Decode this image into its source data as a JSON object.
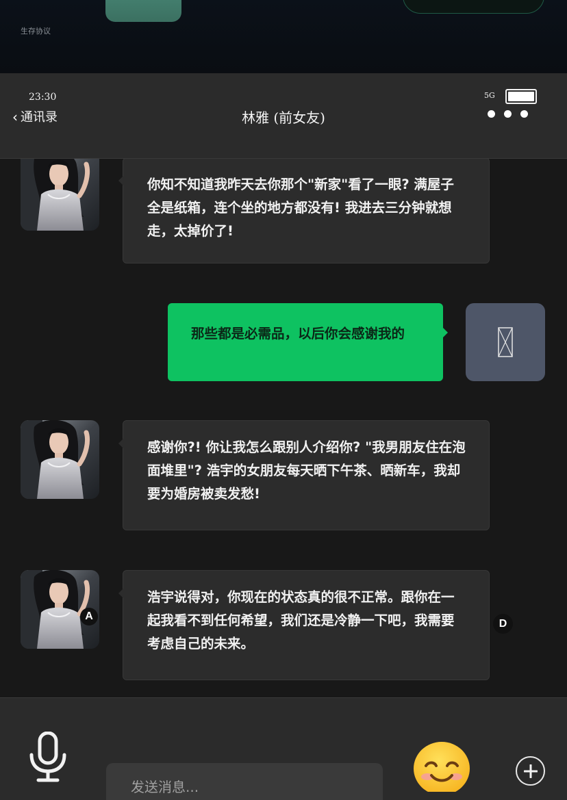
{
  "background_app": {
    "protocol_text": "生存协议"
  },
  "status_bar": {
    "time": "23:30",
    "signal": "5G",
    "battery_level_percent": 100
  },
  "nav": {
    "back_label": "通讯录",
    "back_icon": "chevron-left-icon",
    "title": "林雅 (前女友)",
    "more_icon": "more-dots-icon"
  },
  "messages": [
    {
      "sender": "林雅",
      "direction": "incoming",
      "text": "你知不知道我昨天去你那个\"新家\"看了一眼? 满屋子全是纸箱，连个坐的地方都没有! 我进去三分钟就想走，太掉价了!"
    },
    {
      "sender": "me",
      "direction": "outgoing",
      "text": "那些都是必需品，以后你会感谢我的"
    },
    {
      "sender": "林雅",
      "direction": "incoming",
      "text": "感谢你?! 你让我怎么跟别人介绍你? \"我男朋友住在泡面堆里\"? 浩宇的女朋友每天晒下午茶、晒新车，我却要为婚房被卖发愁!"
    },
    {
      "sender": "林雅",
      "direction": "incoming",
      "text": "浩宇说得对，你现在的状态真的很不正常。跟你在一起我看不到任何希望，我们还是冷静一下吧，我需要考虑自己的未来。"
    }
  ],
  "badges": {
    "avatar_badge": "A",
    "side_badge": "D"
  },
  "input": {
    "placeholder": "发送消息...",
    "mic_icon": "microphone-icon",
    "emoji_icon": "smiling-face-emoji-icon",
    "plus_icon": "plus-circle-icon"
  },
  "colors": {
    "outgoing_bubble": "#0ec261",
    "incoming_bubble": "#2c2c2c",
    "self_avatar_bg": "#4e5668",
    "header_bg": "#2b2b2b"
  }
}
